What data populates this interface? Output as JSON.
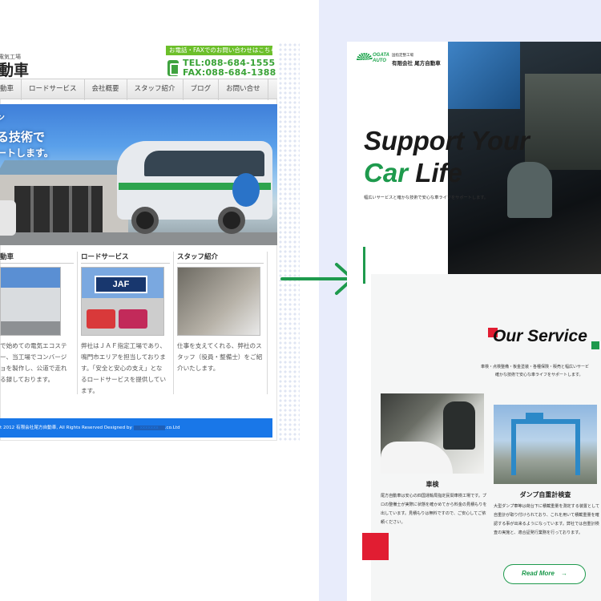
{
  "old_site": {
    "logo_sub": "電気工場",
    "logo": "動車",
    "contact_title": "お電話・FAXでのお問い合わせはこちら",
    "tel": "TEL:088-684-1555",
    "fax": "FAX:088-684-1388",
    "nav": [
      "動車",
      "ロードサービス",
      "会社概要",
      "スタッフ紹介",
      "ブログ",
      "お問い合せ"
    ],
    "hero": {
      "line1": "ン",
      "line2": "る技術で",
      "line3": "ートします。"
    },
    "cards": [
      {
        "title": "動車",
        "text": "で始めての電気エコステー、当工場でコンバージョを製作し、公道で走れる録しております。"
      },
      {
        "title": "ロードサービス",
        "badge": "JAF",
        "text": "弊社はＪＡＦ指定工場であり、鳴門市エリアを担当しております。「安全と安心の支え」となるロードサービスを提供しています。"
      },
      {
        "title": "スタッフ紹介",
        "text": "仕事を支えてくれる、弊社のスタッフ（役員・整備士）をご紹介いたします。"
      }
    ],
    "footer": "t 2012 有限会社尾方自動車, All Rights Reserved Designed by",
    "footer_link": "xxxxxxx",
    "footer_suffix": ".co.Ltd"
  },
  "new_site": {
    "logo_text": "OGATA AUTO",
    "company_sub": "国指定整工場",
    "company": "有限会社 尾方自動車",
    "hero": {
      "line1": "Support Your",
      "line2_car": "Car",
      "line2_life": "Life",
      "desc": "幅広いサービスと確かな技術で安心な車ライフをサポートします。"
    },
    "service": {
      "title": "Our Service",
      "desc1": "車検・点検整備・板金塗装・各種保険・販売と幅広いサービ",
      "desc2": "確かな技術で安心な車ライフをサポートします。"
    },
    "cards": [
      {
        "title": "車検",
        "text": "尾方自動車は安心の四国運輸局指定民間車検工場です。プロの整備士が実際に状態を確かめてから料金の見積もりを出しています。見積もりは無料ですので、ご安心してご依頼ください。"
      },
      {
        "title": "ダンプ自重計検査",
        "text": "大型ダンプ車等は荷台下に積載重量を測定する装置として自重計が取り付けられており、これを用いて積載重量を確認する事が出来るようになっています。弊社では自重計検査の実施と、適合証発行業務を行っております。"
      }
    ],
    "read_more": "Read More",
    "read_more_arrow": "→"
  },
  "colors": {
    "green": "#1e9a4d",
    "red": "#e11d32",
    "old_blue": "#1977e8",
    "panel_blue": "#e8ecfb"
  },
  "icons": [
    "phone-icon",
    "arrow-right-icon",
    "logo-mark-icon"
  ]
}
